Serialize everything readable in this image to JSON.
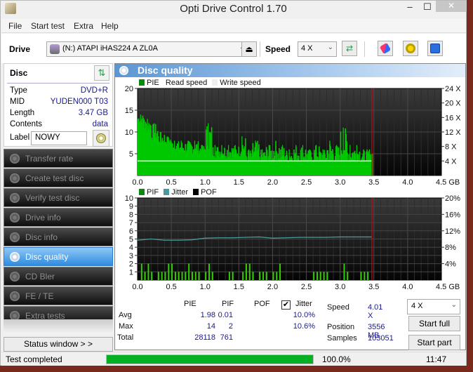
{
  "window": {
    "title": "Opti Drive Control 1.70",
    "minimize": "‒",
    "maximize": "☐",
    "close": "✕"
  },
  "menu": [
    "File",
    "Start test",
    "Extra",
    "Help"
  ],
  "toolbar": {
    "drive_label": "Drive",
    "drive_value": "(N:)   ATAPI iHAS224   A ZL0A",
    "eject_icon": "⏏",
    "speed_label": "Speed",
    "speed_value": "4 X",
    "refresh_icon": "⇄",
    "erase_icon": "eraser",
    "settings_icon": "settings",
    "save_icon": "save"
  },
  "disc": {
    "heading": "Disc",
    "rows": [
      {
        "key": "Type",
        "value": "DVD+R"
      },
      {
        "key": "MID",
        "value": "YUDEN000 T03"
      },
      {
        "key": "Length",
        "value": "3.47 GB"
      },
      {
        "key": "Contents",
        "value": "data"
      }
    ],
    "label_key": "Label",
    "label_value": "NOWY"
  },
  "nav": [
    {
      "label": "Transfer rate",
      "active": false
    },
    {
      "label": "Create test disc",
      "active": false
    },
    {
      "label": "Verify test disc",
      "active": false
    },
    {
      "label": "Drive info",
      "active": false
    },
    {
      "label": "Disc info",
      "active": false
    },
    {
      "label": "Disc quality",
      "active": true
    },
    {
      "label": "CD Bler",
      "active": false
    },
    {
      "label": "FE / TE",
      "active": false
    },
    {
      "label": "Extra tests",
      "active": false
    }
  ],
  "status_window_button": "Status window > >",
  "panel_title": "Disc quality",
  "colors": {
    "pie": "#00c800",
    "pif": "#33cc00",
    "jitter": "#4a9a9a",
    "pof": "#000000",
    "marker": "#e00000",
    "read_speed": "#ffffff",
    "accent": "#3b8ee0",
    "progress": "#06b025"
  },
  "chart_data": [
    {
      "type": "bar",
      "title": "PIE",
      "legend": [
        "PIE",
        "Read speed",
        "Write speed"
      ],
      "xlabel": "GB",
      "x_ticks": [
        "0.0",
        "0.5",
        "1.0",
        "1.5",
        "2.0",
        "2.5",
        "3.0",
        "3.5",
        "4.0",
        "4.5 GB"
      ],
      "xlim": [
        0,
        4.5
      ],
      "y_left_ticks": [
        "5",
        "10",
        "15",
        "20"
      ],
      "ylim_left": [
        0,
        20
      ],
      "y_right_ticks": [
        "4 X",
        "8 X",
        "12 X",
        "16 X",
        "20 X",
        "24 X"
      ],
      "ylim_right": [
        0,
        24
      ],
      "end_marker_gb": 3.47,
      "read_speed_x": 4.0,
      "series": [
        {
          "name": "PIE",
          "x": [
            0.0,
            0.1,
            0.2,
            0.3,
            0.4,
            0.5,
            0.6,
            0.7,
            0.8,
            0.9,
            1.0,
            1.1,
            1.2,
            1.3,
            1.4,
            1.5,
            1.6,
            1.7,
            1.8,
            1.9,
            2.0,
            2.1,
            2.2,
            2.3,
            2.4,
            2.5,
            2.6,
            2.7,
            2.8,
            2.9,
            3.0,
            3.1,
            3.2,
            3.3,
            3.4,
            3.47
          ],
          "values": [
            12,
            10,
            8,
            7,
            7,
            6,
            5,
            5,
            5,
            5,
            5,
            4,
            4,
            4,
            4,
            4,
            3,
            3,
            3,
            3,
            3,
            3,
            3,
            3,
            3,
            3,
            3,
            3,
            3,
            3,
            3,
            3,
            3,
            3,
            3,
            3
          ],
          "max_values": [
            14,
            13,
            12,
            10,
            9,
            8,
            8,
            8,
            8,
            7,
            12,
            7,
            7,
            7,
            7,
            9,
            6,
            8,
            6,
            7,
            8,
            7,
            6,
            7,
            7,
            6,
            7,
            6,
            8,
            7,
            11,
            7,
            7,
            6,
            6,
            5
          ]
        }
      ]
    },
    {
      "type": "bar",
      "title": "PIF / Jitter",
      "legend": [
        "PIF",
        "Jitter",
        "POF"
      ],
      "xlabel": "GB",
      "x_ticks": [
        "0.0",
        "0.5",
        "1.0",
        "1.5",
        "2.0",
        "2.5",
        "3.0",
        "3.5",
        "4.0",
        "4.5 GB"
      ],
      "xlim": [
        0,
        4.5
      ],
      "y_left_ticks": [
        "1",
        "2",
        "3",
        "4",
        "5",
        "6",
        "7",
        "8",
        "9",
        "10"
      ],
      "ylim_left": [
        0,
        10
      ],
      "y_right_ticks": [
        "4%",
        "8%",
        "12%",
        "16%",
        "20%"
      ],
      "ylim_right": [
        0,
        20
      ],
      "end_marker_gb": 3.47,
      "series": [
        {
          "name": "PIF",
          "x": [
            0.05,
            0.1,
            0.15,
            0.2,
            0.3,
            0.35,
            0.4,
            0.45,
            0.5,
            0.55,
            0.6,
            0.65,
            0.7,
            0.75,
            0.8,
            0.85,
            0.9,
            1.0,
            1.05,
            1.1,
            1.35,
            1.4,
            1.55,
            1.6,
            1.65,
            1.7,
            1.8,
            1.85,
            1.9,
            2.0,
            2.05,
            2.1,
            2.6,
            2.65,
            2.7,
            2.75,
            2.8,
            3.05,
            3.1,
            3.3,
            3.35,
            3.4
          ],
          "values": [
            2,
            1,
            2,
            1,
            1,
            1,
            1,
            2,
            2,
            1,
            1,
            1,
            1,
            2,
            1,
            1,
            1,
            1,
            2,
            1,
            1,
            1,
            1,
            2,
            2,
            1,
            1,
            1,
            1,
            1,
            1,
            2,
            1,
            1,
            1,
            1,
            1,
            2,
            1,
            1,
            1,
            1
          ]
        },
        {
          "name": "Jitter",
          "x": [
            0.0,
            0.2,
            0.4,
            0.6,
            0.8,
            1.0,
            1.2,
            1.4,
            1.6,
            1.8,
            2.0,
            2.2,
            2.4,
            2.6,
            2.8,
            3.0,
            3.2,
            3.4
          ],
          "values": [
            9.7,
            10.0,
            9.7,
            9.7,
            9.8,
            10.2,
            10.3,
            10.3,
            10.4,
            10.5,
            10.2,
            10.3,
            10.4,
            10.4,
            10.4,
            10.5,
            10.5,
            10.5
          ]
        },
        {
          "name": "POF",
          "x": [],
          "values": []
        }
      ]
    }
  ],
  "stats": {
    "col_headers": [
      "PIE",
      "PIF",
      "POF",
      "Jitter"
    ],
    "jitter_checked": true,
    "rows": [
      {
        "label": "Avg",
        "pie": "1.98",
        "pif": "0.01",
        "pof": "",
        "jitter": "10.0%"
      },
      {
        "label": "Max",
        "pie": "14",
        "pif": "2",
        "pof": "",
        "jitter": "10.6%"
      },
      {
        "label": "Total",
        "pie": "28118",
        "pif": "761",
        "pof": "",
        "jitter": ""
      }
    ],
    "speed_label": "Speed",
    "speed_value": "4.01 X",
    "position_label": "Position",
    "position_value": "3556 MB",
    "samples_label": "Samples",
    "samples_value": "103051",
    "speed_select": "4 X",
    "start_full": "Start full",
    "start_part": "Start part"
  },
  "statusbar": {
    "text": "Test completed",
    "progress": 1.0,
    "percent": "100.0%",
    "time": "11:47"
  }
}
